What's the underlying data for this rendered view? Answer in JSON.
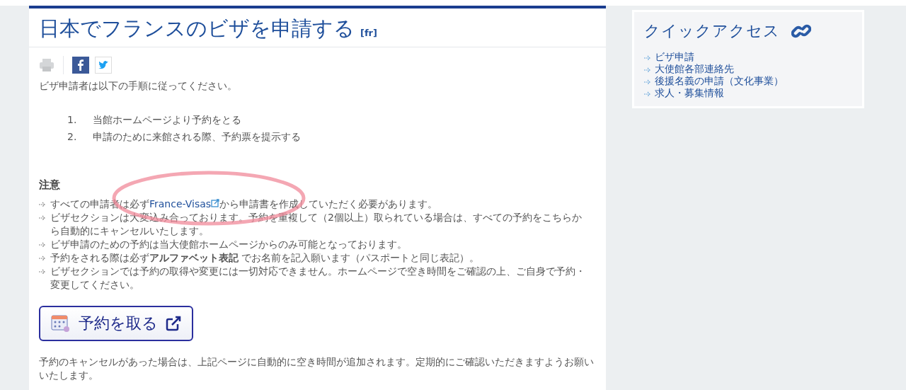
{
  "article": {
    "title": "日本でフランスのビザを申請する",
    "lang_link": "[fr]",
    "intro": "ビザ申請者は以下の手順に従ってください。",
    "steps": [
      {
        "number": "1.",
        "text": "当館ホームページより予約をとる"
      },
      {
        "number": "2.",
        "text": "申請のために来館される際、予約票を提示する"
      }
    ],
    "notice_heading": "注意",
    "notices": [
      {
        "before": "すべての申請者は必ず",
        "link": "France-Visas",
        "after": "から申請書を作成していただく必要があります。"
      },
      {
        "before": "ビザセクションは大変込み合っております。予約を重複して（2個以上）取られている場合は、すべての予約をこちらから自動的にキャンセルいたします。"
      },
      {
        "before": "ビザ申請のための予約は当大使館ホームページからのみ可能となっております。"
      },
      {
        "before": "予約をされる際は必ず**アルファベット表記** でお名前を記入願います（パスポートと同じ表記）。"
      },
      {
        "before": "ビザセクションでは予約の取得や変更には一切対応できません。ホームページで空き時間をご確認の上、ご自身で予約・変更してください。"
      }
    ],
    "booking_button": "予約を取る",
    "footer_note": "予約のキャンセルがあった場合は、上記ページに自動的に空き時間が追加されます。定期的にご確認いただきますようお願いいたします。"
  },
  "quick_access": {
    "title": "クイックアクセス",
    "links": [
      "ビザ申請",
      "大使館各部連絡先",
      "後援名義の申請（文化事業）",
      "求人・募集情報"
    ]
  }
}
